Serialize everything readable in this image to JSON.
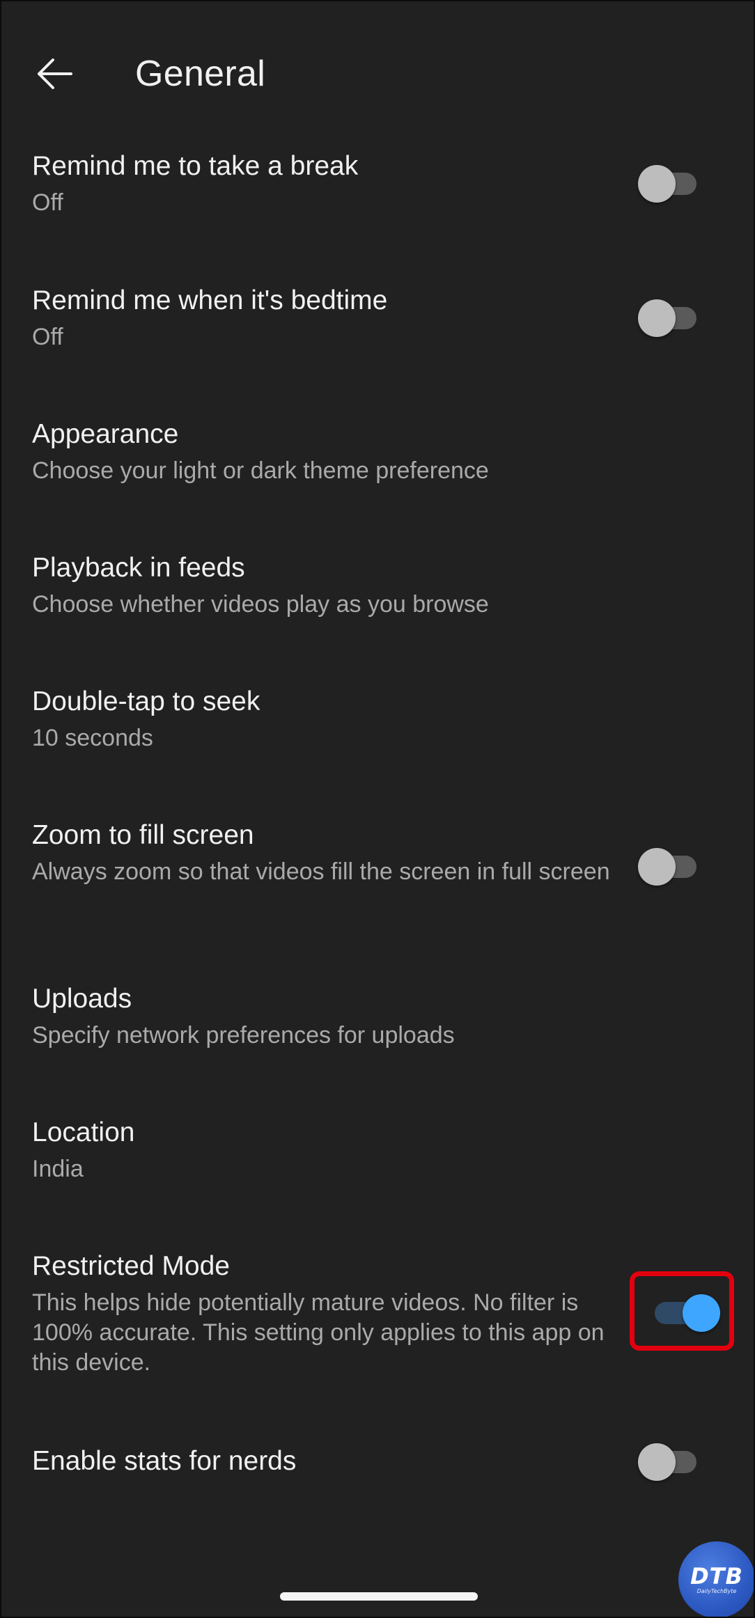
{
  "header": {
    "back_icon": "arrow-left-icon",
    "title": "General"
  },
  "settings": [
    {
      "title": "Remind me to take a break",
      "subtitle": "Off",
      "toggle": false
    },
    {
      "title": "Remind me when it's bedtime",
      "subtitle": "Off",
      "toggle": false
    },
    {
      "title": "Appearance",
      "subtitle": "Choose your light or dark theme preference"
    },
    {
      "title": "Playback in feeds",
      "subtitle": "Choose whether videos play as you browse"
    },
    {
      "title": "Double-tap to seek",
      "subtitle": "10 seconds"
    },
    {
      "title": "Zoom to fill screen",
      "subtitle": "Always zoom so that videos fill the screen in full screen",
      "toggle": false
    },
    {
      "title": "Uploads",
      "subtitle": "Specify network preferences for uploads"
    },
    {
      "title": "Location",
      "subtitle": "India"
    },
    {
      "title": "Restricted Mode",
      "subtitle": "This helps hide potentially mature videos. No filter is 100% accurate. This setting only applies to this app on this device.",
      "toggle": true
    },
    {
      "title": "Enable stats for nerds",
      "toggle": false
    }
  ],
  "colors": {
    "background": "#212121",
    "text_primary": "#f1f1f1",
    "text_secondary": "#aaaaaa",
    "toggle_on": "#3ea6ff",
    "highlight": "#e2000f"
  },
  "watermark": {
    "main": "DTB",
    "sub": "DailyTechByte"
  }
}
